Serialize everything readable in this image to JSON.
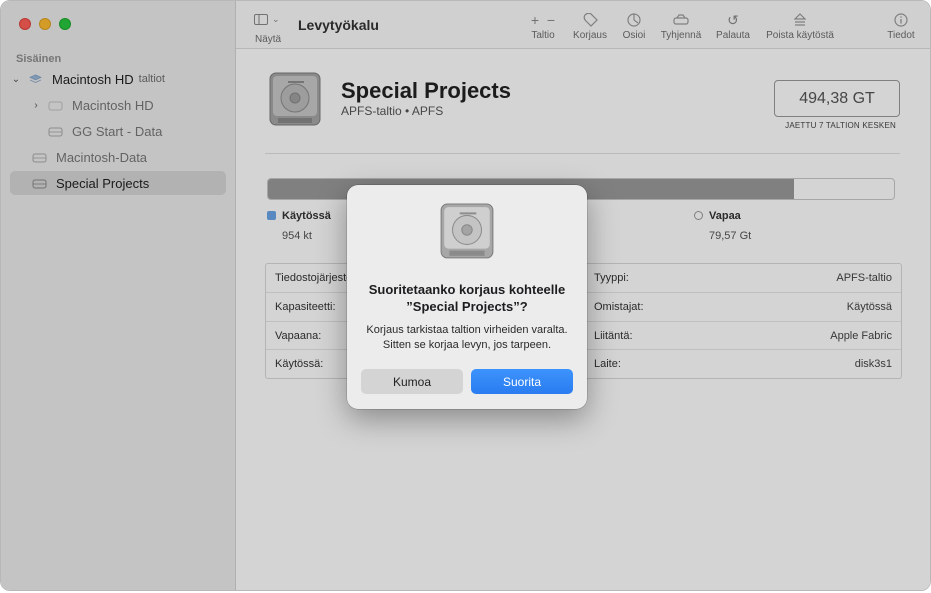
{
  "app": {
    "title": "Levytyökalu"
  },
  "toolbar": {
    "view_label": "Näytä",
    "buttons": [
      {
        "icon": "plus-minus-icon",
        "label": "Taltio"
      },
      {
        "icon": "first-aid-icon",
        "label": "Korjaus"
      },
      {
        "icon": "partition-icon",
        "label": "Osioi"
      },
      {
        "icon": "erase-icon",
        "label": "Tyhjennä"
      },
      {
        "icon": "restore-icon",
        "label": "Palauta"
      },
      {
        "icon": "unmount-icon",
        "label": "Poista käytöstä"
      },
      {
        "icon": "info-icon",
        "label": "Tiedot"
      }
    ]
  },
  "sidebar": {
    "section": "Sisäinen",
    "items": [
      {
        "label": "Macintosh HD",
        "sub": "taltiot"
      },
      {
        "label": "Macintosh HD"
      },
      {
        "label": "GG Start - Data"
      },
      {
        "label": "Macintosh-Data"
      },
      {
        "label": "Special Projects"
      }
    ]
  },
  "volume": {
    "name": "Special Projects",
    "subtitle": "APFS-taltio • APFS",
    "capacity": "494,38 GT",
    "capacity_note": "JAETTU 7 TALTION KESKEN",
    "used_fraction": 0.84,
    "legend": {
      "used_label": "Käytössä",
      "used_value": "954 kt",
      "free_label": "Vapaa",
      "free_value": "79,57 Gt"
    },
    "info_left": [
      {
        "label": "Tiedostojärjestelmä:"
      },
      {
        "label": "Kapasiteetti:"
      },
      {
        "label": "Vapaana:"
      },
      {
        "label": "Käytössä:"
      }
    ],
    "info_right": [
      {
        "label": "Tyyppi:",
        "value": "APFS-taltio"
      },
      {
        "label": "Omistajat:",
        "value": "Käytössä"
      },
      {
        "label": "Liitäntä:",
        "value": "Apple Fabric"
      },
      {
        "label": "Laite:",
        "value": "disk3s1"
      }
    ]
  },
  "dialog": {
    "title_line1": "Suoritetaanko korjaus kohteelle",
    "title_line2": "”Special Projects”?",
    "message_line1": "Korjaus tarkistaa taltion virheiden varalta.",
    "message_line2": "Sitten se korjaa levyn, jos tarpeen.",
    "cancel_label": "Kumoa",
    "ok_label": "Suorita"
  },
  "colors": {
    "accent": "#2a7cf0",
    "used_bar": "#9a9a9a",
    "used_dot": "#6aa7e8"
  }
}
